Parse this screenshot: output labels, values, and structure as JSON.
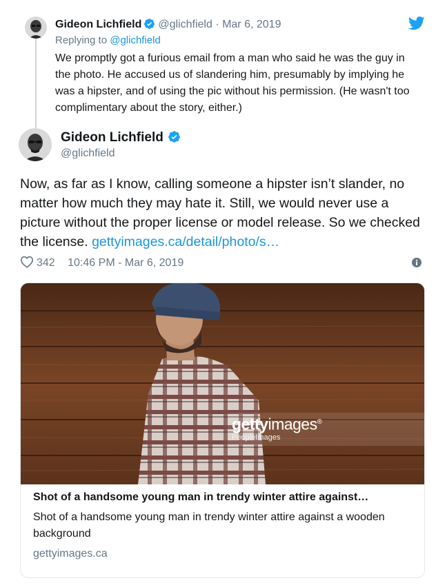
{
  "parent_tweet": {
    "author_name": "Gideon Lichfield",
    "handle": "@glichfield",
    "separator": "·",
    "date": "Mar 6, 2019",
    "replying_prefix": "Replying to",
    "replying_handle": "@glichfield",
    "text": "We promptly got a furious email from a man who said he was the guy in the photo. He accused us of slandering him, presumably by implying he was a hipster, and of using the pic without his permission. (He wasn't too complimentary about the story, either.)"
  },
  "main_tweet": {
    "author_name": "Gideon Lichfield",
    "handle": "@glichfield",
    "text": "Now, as far as I know, calling someone a hipster isn’t slander, no matter how much they may hate it. Still, we would never use a picture without the proper license or model release. So we checked the license. ",
    "link_text": "gettyimages.ca/detail/photo/s…",
    "likes": "342",
    "timestamp": "10:46 PM - Mar 6, 2019"
  },
  "link_card": {
    "watermark_brand_bold": "getty",
    "watermark_brand_rest": "images",
    "watermark_brand_mark": "®",
    "watermark_sub": "PeopleImages",
    "title": "Shot of a handsome young man in trendy winter attire against…",
    "description": "Shot of a handsome young man in trendy winter attire against a wooden background",
    "domain": "gettyimages.ca"
  },
  "icons": {
    "verified": "verified-badge-icon",
    "bird": "twitter-bird-icon",
    "like": "heart-icon",
    "info": "info-icon"
  },
  "colors": {
    "link": "#1b95e0",
    "verified": "#1da1f2",
    "secondary_text": "#657786",
    "primary_text": "#14171a"
  }
}
